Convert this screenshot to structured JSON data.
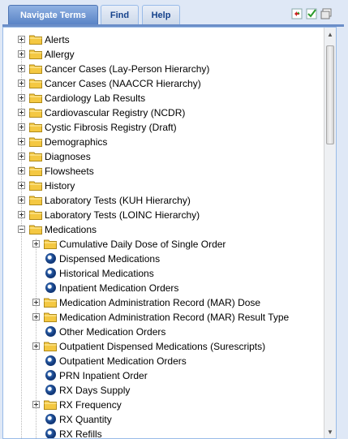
{
  "tabs": [
    {
      "label": "Navigate Terms",
      "active": true
    },
    {
      "label": "Find",
      "active": false
    },
    {
      "label": "Help",
      "active": false
    }
  ],
  "toolbar_icons": [
    "refresh-icon",
    "check-icon",
    "window-icon"
  ],
  "tree": {
    "root_items": [
      "Alerts",
      "Allergy",
      "Cancer Cases (Lay-Person Hierarchy)",
      "Cancer Cases (NAACCR Hierarchy)",
      "Cardiology Lab Results",
      "Cardiovascular Registry (NCDR)",
      "Cystic Fibrosis Registry (Draft)",
      "Demographics",
      "Diagnoses",
      "Flowsheets",
      "History",
      "Laboratory Tests (KUH Hierarchy)",
      "Laboratory Tests (LOINC Hierarchy)",
      "Medications"
    ],
    "medications_children": [
      {
        "label": "Cumulative Daily Dose of Single Order",
        "type": "folder"
      },
      {
        "label": "Dispensed Medications",
        "type": "leaf"
      },
      {
        "label": "Historical Medications",
        "type": "leaf"
      },
      {
        "label": "Inpatient Medication Orders",
        "type": "leaf"
      },
      {
        "label": "Medication Administration Record (MAR) Dose",
        "type": "folder"
      },
      {
        "label": "Medication Administration Record (MAR) Result Type",
        "type": "folder"
      },
      {
        "label": "Other Medication Orders",
        "type": "leaf"
      },
      {
        "label": "Outpatient Dispensed Medications (Surescripts)",
        "type": "folder"
      },
      {
        "label": "Outpatient Medication Orders",
        "type": "leaf"
      },
      {
        "label": "PRN Inpatient Order",
        "type": "leaf"
      },
      {
        "label": "RX Days Supply",
        "type": "leaf"
      },
      {
        "label": "RX Frequency",
        "type": "folder"
      },
      {
        "label": "RX Quantity",
        "type": "leaf"
      },
      {
        "label": "RX Refills",
        "type": "leaf"
      }
    ]
  },
  "colors": {
    "accent": "#15428b",
    "active_tab": "#5a84c6",
    "border": "#99bbe8"
  }
}
